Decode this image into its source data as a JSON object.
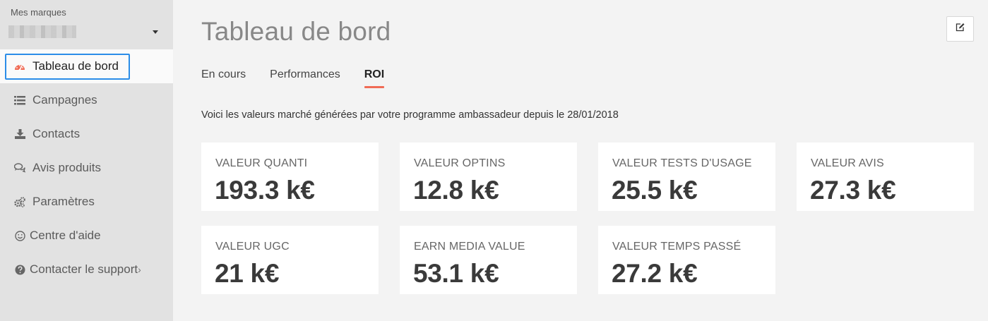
{
  "sidebar": {
    "brand_label": "Mes marques",
    "items": [
      {
        "label": "Tableau de bord",
        "icon": "dashboard-gauge-icon",
        "active": true
      },
      {
        "label": "Campagnes",
        "icon": "list-icon"
      },
      {
        "label": "Contacts",
        "icon": "download-icon"
      },
      {
        "label": "Avis produits",
        "icon": "comments-icon"
      },
      {
        "label": "Paramètres",
        "icon": "gears-icon"
      },
      {
        "label": "Centre d'aide",
        "icon": "smile-icon"
      },
      {
        "label": "Contacter le support",
        "icon": "question-circle-icon",
        "arrow": "›"
      }
    ]
  },
  "main": {
    "title": "Tableau de bord",
    "tabs": [
      {
        "label": "En cours"
      },
      {
        "label": "Performances"
      },
      {
        "label": "ROI",
        "active": true
      }
    ],
    "intro": "Voici les valeurs marché générées par votre programme ambassadeur depuis le 28/01/2018",
    "cards": [
      {
        "label": "VALEUR QUANTI",
        "value": "193.3 k€"
      },
      {
        "label": "VALEUR OPTINS",
        "value": "12.8 k€"
      },
      {
        "label": "VALEUR TESTS D'USAGE",
        "value": "25.5 k€"
      },
      {
        "label": "VALEUR AVIS",
        "value": "27.3 k€"
      },
      {
        "label": "VALEUR UGC",
        "value": "21 k€"
      },
      {
        "label": "EARN MEDIA VALUE",
        "value": "53.1 k€"
      },
      {
        "label": "VALEUR TEMPS PASSÉ",
        "value": "27.2 k€"
      }
    ]
  },
  "colors": {
    "accent": "#f06b55",
    "focus": "#2b8de8",
    "sidebar_bg": "#e2e2e2",
    "main_bg": "#f3f3f3"
  }
}
